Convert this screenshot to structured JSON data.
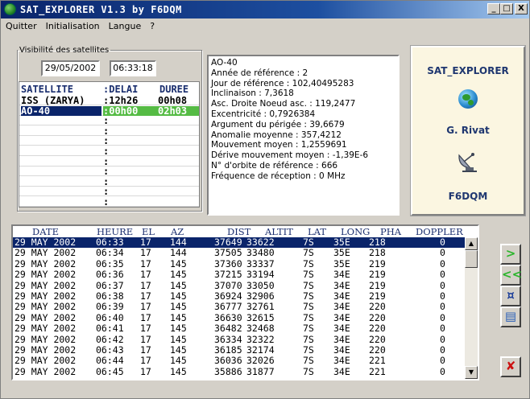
{
  "window": {
    "title": "SAT_EXPLORER V1.3 by F6DQM",
    "controls": {
      "minimize": "_",
      "maximize": "□",
      "close": "X"
    }
  },
  "menu": [
    "Quitter",
    "Initialisation",
    "Langue",
    "?"
  ],
  "visibility": {
    "legend": "Visibilité des satellites",
    "date": "29/05/2002",
    "time": "06:33:18",
    "headers": {
      "satellite": "SATELLITE",
      "delai": ":DELAI",
      "duree": "DUREE"
    },
    "rows": [
      {
        "satellite": "ISS (ZARYA)",
        "delai": ":12h26",
        "duree": "00h08"
      },
      {
        "satellite": "AO-40",
        "delai": ":00h00",
        "duree": "02h03",
        "selected": true
      },
      {
        "satellite": "",
        "delai": ":",
        "duree": ""
      },
      {
        "satellite": "",
        "delai": ":",
        "duree": ""
      },
      {
        "satellite": "",
        "delai": ":",
        "duree": ""
      },
      {
        "satellite": "",
        "delai": ":",
        "duree": ""
      },
      {
        "satellite": "",
        "delai": ":",
        "duree": ""
      },
      {
        "satellite": "",
        "delai": ":",
        "duree": ""
      },
      {
        "satellite": "",
        "delai": ":",
        "duree": ""
      },
      {
        "satellite": "",
        "delai": ":",
        "duree": ""
      },
      {
        "satellite": "",
        "delai": ":",
        "duree": ""
      }
    ]
  },
  "orbital_info": [
    "AO-40",
    "Année de référence : 2",
    "Jour de référence : 102,40495283",
    "Inclinaison : 7,3618",
    "Asc. Droite Noeud asc. : 119,2477",
    "Excentricité : 0,7926384",
    "Argument du périgée : 39,6679",
    "Anomalie moyenne : 357,4212",
    "Mouvement moyen : 1,2559691",
    "Dérive mouvement moyen : -1,39E-6",
    "N° d'orbite de référence : 666",
    "Fréquence de réception : 0 MHz"
  ],
  "logo": {
    "app": "SAT_EXPLORER",
    "author": "G. Rivat",
    "callsign": "F6DQM"
  },
  "pass_table": {
    "headers": [
      "DATE",
      "HEURE",
      "EL",
      "AZ",
      "DIST",
      "ALTIT",
      "LAT",
      "LONG",
      "PHA",
      "DOPPLER"
    ],
    "rows": [
      [
        "29 MAY 2002",
        "06:33",
        "17",
        "144",
        "37649",
        "33622",
        "7S",
        "35E",
        "218",
        "0"
      ],
      [
        "29 MAY 2002",
        "06:34",
        "17",
        "144",
        "37505",
        "33480",
        "7S",
        "35E",
        "218",
        "0"
      ],
      [
        "29 MAY 2002",
        "06:35",
        "17",
        "145",
        "37360",
        "33337",
        "7S",
        "35E",
        "219",
        "0"
      ],
      [
        "29 MAY 2002",
        "06:36",
        "17",
        "145",
        "37215",
        "33194",
        "7S",
        "34E",
        "219",
        "0"
      ],
      [
        "29 MAY 2002",
        "06:37",
        "17",
        "145",
        "37070",
        "33050",
        "7S",
        "34E",
        "219",
        "0"
      ],
      [
        "29 MAY 2002",
        "06:38",
        "17",
        "145",
        "36924",
        "32906",
        "7S",
        "34E",
        "219",
        "0"
      ],
      [
        "29 MAY 2002",
        "06:39",
        "17",
        "145",
        "36777",
        "32761",
        "7S",
        "34E",
        "220",
        "0"
      ],
      [
        "29 MAY 2002",
        "06:40",
        "17",
        "145",
        "36630",
        "32615",
        "7S",
        "34E",
        "220",
        "0"
      ],
      [
        "29 MAY 2002",
        "06:41",
        "17",
        "145",
        "36482",
        "32468",
        "7S",
        "34E",
        "220",
        "0"
      ],
      [
        "29 MAY 2002",
        "06:42",
        "17",
        "145",
        "36334",
        "32322",
        "7S",
        "34E",
        "220",
        "0"
      ],
      [
        "29 MAY 2002",
        "06:43",
        "17",
        "145",
        "36185",
        "32174",
        "7S",
        "34E",
        "220",
        "0"
      ],
      [
        "29 MAY 2002",
        "06:44",
        "17",
        "145",
        "36036",
        "32026",
        "7S",
        "34E",
        "221",
        "0"
      ],
      [
        "29 MAY 2002",
        "06:45",
        "17",
        "145",
        "35886",
        "31877",
        "7S",
        "34E",
        "221",
        "0"
      ]
    ],
    "selected_row": 0
  },
  "side_buttons": [
    {
      "icon": "next-arrow-icon",
      "glyph": ">",
      "color": "#2bb52b"
    },
    {
      "icon": "rewind-arrow-icon",
      "glyph": "<<",
      "color": "#2bb52b"
    },
    {
      "icon": "settings-icon",
      "glyph": "¤",
      "color": "#1d3f9a"
    },
    {
      "icon": "printer-icon",
      "glyph": "▤",
      "color": "#2a60b8"
    },
    {
      "icon": "close-icon",
      "glyph": "✘",
      "color": "#cc1111"
    }
  ],
  "colors": {
    "title_bar": "#0a246a",
    "selection": "#0a246a",
    "highlight_green": "#55bb44",
    "header_text": "#1a2e6e"
  }
}
